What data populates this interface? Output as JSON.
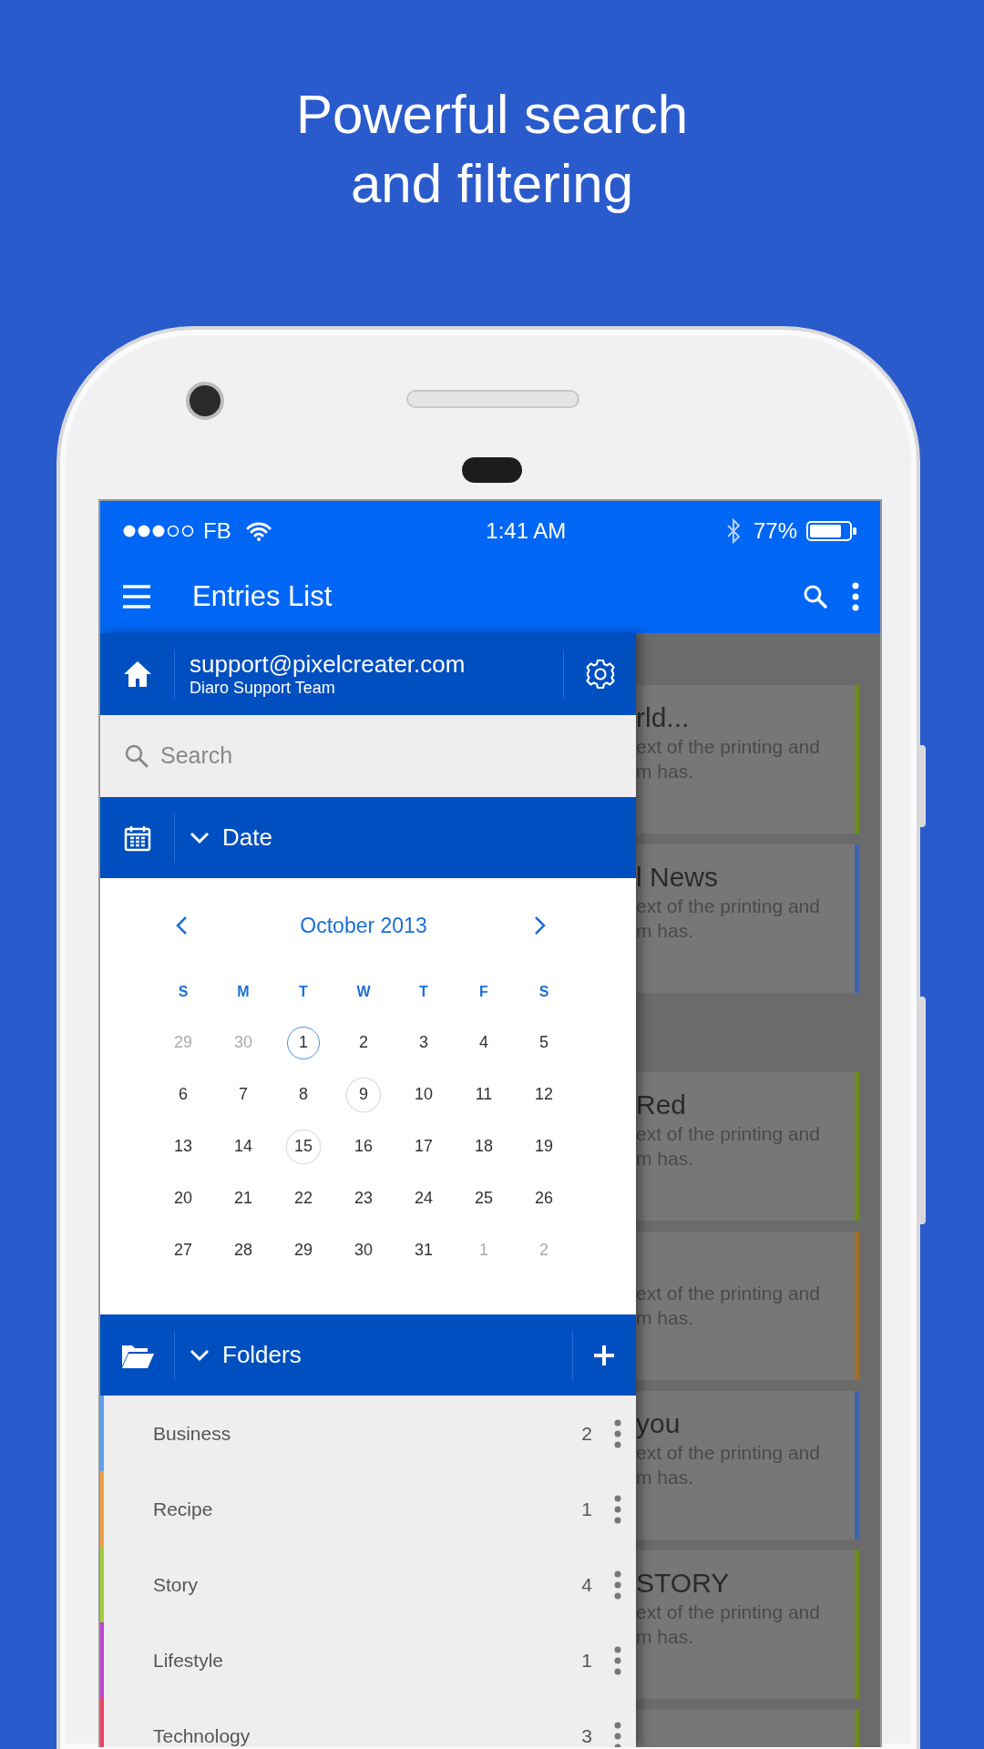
{
  "headline": [
    "Powerful search",
    "and filtering"
  ],
  "status_bar": {
    "carrier": "FB",
    "time": "1:41 AM",
    "battery": "77%"
  },
  "app_bar": {
    "title": "Entries List"
  },
  "drawer": {
    "account": {
      "email": "support@pixelcreater.com",
      "name": "Diaro Support Team"
    },
    "search": {
      "placeholder": "Search"
    },
    "date_section": {
      "title": "Date",
      "expanded": true
    },
    "calendar": {
      "month": "October 2013",
      "weekdays": [
        "S",
        "M",
        "T",
        "W",
        "T",
        "F",
        "S"
      ],
      "days": [
        {
          "label": "29",
          "outside": true,
          "today": false,
          "has_entries": false
        },
        {
          "label": "30",
          "outside": true,
          "today": false,
          "has_entries": false
        },
        {
          "label": "1",
          "outside": false,
          "today": true,
          "has_entries": false
        },
        {
          "label": "2",
          "outside": false,
          "today": false,
          "has_entries": false
        },
        {
          "label": "3",
          "outside": false,
          "today": false,
          "has_entries": false
        },
        {
          "label": "4",
          "outside": false,
          "today": false,
          "has_entries": false
        },
        {
          "label": "5",
          "outside": false,
          "today": false,
          "has_entries": false
        },
        {
          "label": "6",
          "outside": false,
          "today": false,
          "has_entries": false
        },
        {
          "label": "7",
          "outside": false,
          "today": false,
          "has_entries": false
        },
        {
          "label": "8",
          "outside": false,
          "today": false,
          "has_entries": false
        },
        {
          "label": "9",
          "outside": false,
          "today": false,
          "has_entries": true
        },
        {
          "label": "10",
          "outside": false,
          "today": false,
          "has_entries": false
        },
        {
          "label": "11",
          "outside": false,
          "today": false,
          "has_entries": false
        },
        {
          "label": "12",
          "outside": false,
          "today": false,
          "has_entries": false
        },
        {
          "label": "13",
          "outside": false,
          "today": false,
          "has_entries": false
        },
        {
          "label": "14",
          "outside": false,
          "today": false,
          "has_entries": false
        },
        {
          "label": "15",
          "outside": false,
          "today": false,
          "has_entries": true
        },
        {
          "label": "16",
          "outside": false,
          "today": false,
          "has_entries": false
        },
        {
          "label": "17",
          "outside": false,
          "today": false,
          "has_entries": false
        },
        {
          "label": "18",
          "outside": false,
          "today": false,
          "has_entries": false
        },
        {
          "label": "19",
          "outside": false,
          "today": false,
          "has_entries": false
        },
        {
          "label": "20",
          "outside": false,
          "today": false,
          "has_entries": false
        },
        {
          "label": "21",
          "outside": false,
          "today": false,
          "has_entries": false
        },
        {
          "label": "22",
          "outside": false,
          "today": false,
          "has_entries": false
        },
        {
          "label": "23",
          "outside": false,
          "today": false,
          "has_entries": false
        },
        {
          "label": "24",
          "outside": false,
          "today": false,
          "has_entries": false
        },
        {
          "label": "25",
          "outside": false,
          "today": false,
          "has_entries": false
        },
        {
          "label": "26",
          "outside": false,
          "today": false,
          "has_entries": false
        },
        {
          "label": "27",
          "outside": false,
          "today": false,
          "has_entries": false
        },
        {
          "label": "28",
          "outside": false,
          "today": false,
          "has_entries": false
        },
        {
          "label": "29",
          "outside": false,
          "today": false,
          "has_entries": false
        },
        {
          "label": "30",
          "outside": false,
          "today": false,
          "has_entries": false
        },
        {
          "label": "31",
          "outside": false,
          "today": false,
          "has_entries": false
        },
        {
          "label": "1",
          "outside": true,
          "today": false,
          "has_entries": false
        },
        {
          "label": "2",
          "outside": true,
          "today": false,
          "has_entries": false
        }
      ]
    },
    "folders_section": {
      "title": "Folders",
      "expanded": true
    },
    "folders": [
      {
        "label": "Business",
        "count": "2",
        "color": "#5aa0f0"
      },
      {
        "label": "Recipe",
        "count": "1",
        "color": "#f0a040"
      },
      {
        "label": "Story",
        "count": "4",
        "color": "#a0d030"
      },
      {
        "label": "Lifestyle",
        "count": "1",
        "color": "#c040d0"
      },
      {
        "label": "Technology",
        "count": "3",
        "color": "#f04060"
      }
    ]
  },
  "entries": [
    {
      "title": "rld...",
      "snippet": [
        "ext of the printing and",
        "m has."
      ],
      "color": "#6b8c1a"
    },
    {
      "title": "l News",
      "snippet": [
        "ext of the printing and",
        "m has."
      ],
      "color": "#3d62a8"
    },
    {
      "kind": "gap"
    },
    {
      "title": "Red",
      "snippet": [
        "ext of the printing and",
        "m has."
      ],
      "color": "#6b8c1a"
    },
    {
      "snippet": [
        "ext of the printing and",
        "m has."
      ],
      "color": "#a0702a"
    },
    {
      "title": "you",
      "snippet": [
        "ext of the printing and",
        "m has."
      ],
      "color": "#3d62a8"
    },
    {
      "title": "STORY",
      "snippet": [
        "ext of the printing and",
        "m has."
      ],
      "color": "#6b8c1a"
    },
    {
      "color": "#6b8c1a"
    }
  ]
}
